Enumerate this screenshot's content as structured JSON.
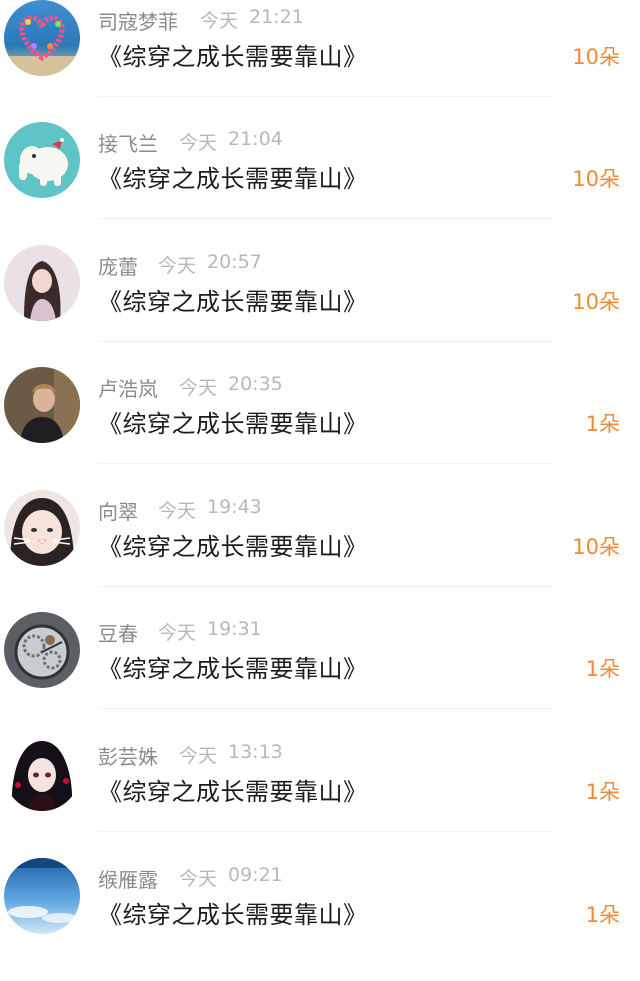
{
  "records": [
    {
      "user": "司寇梦菲",
      "day": "今天",
      "time": "21:21",
      "gift": "《综穿之成长需要靠山》",
      "amount": "10朵",
      "avatar_icon": "heart-balloons-icon"
    },
    {
      "user": "接飞兰",
      "day": "今天",
      "time": "21:04",
      "gift": "《综穿之成长需要靠山》",
      "amount": "10朵",
      "avatar_icon": "elephant-icon"
    },
    {
      "user": "庞蕾",
      "day": "今天",
      "time": "20:57",
      "gift": "《综穿之成长需要靠山》",
      "amount": "10朵",
      "avatar_icon": "girl-photo-icon"
    },
    {
      "user": "卢浩岚",
      "day": "今天",
      "time": "20:35",
      "gift": "《综穿之成长需要靠山》",
      "amount": "1朵",
      "avatar_icon": "man-photo-icon"
    },
    {
      "user": "向翠",
      "day": "今天",
      "time": "19:43",
      "gift": "《综穿之成长需要靠山》",
      "amount": "10朵",
      "avatar_icon": "cat-filter-girl-icon"
    },
    {
      "user": "豆春",
      "day": "今天",
      "time": "19:31",
      "gift": "《综穿之成长需要靠山》",
      "amount": "1朵",
      "avatar_icon": "watch-gears-icon"
    },
    {
      "user": "彭芸姝",
      "day": "今天",
      "time": "13:13",
      "gift": "《综穿之成长需要靠山》",
      "amount": "1朵",
      "avatar_icon": "anime-girl-icon"
    },
    {
      "user": "缑雁露",
      "day": "今天",
      "time": "09:21",
      "gift": "《综穿之成长需要靠山》",
      "amount": "1朵",
      "avatar_icon": "blue-sky-icon"
    }
  ],
  "colors": {
    "amount": "#f08a34",
    "name": "#8b8b8b",
    "timestamp": "#b8b8b8",
    "title": "#1c1c1c"
  }
}
